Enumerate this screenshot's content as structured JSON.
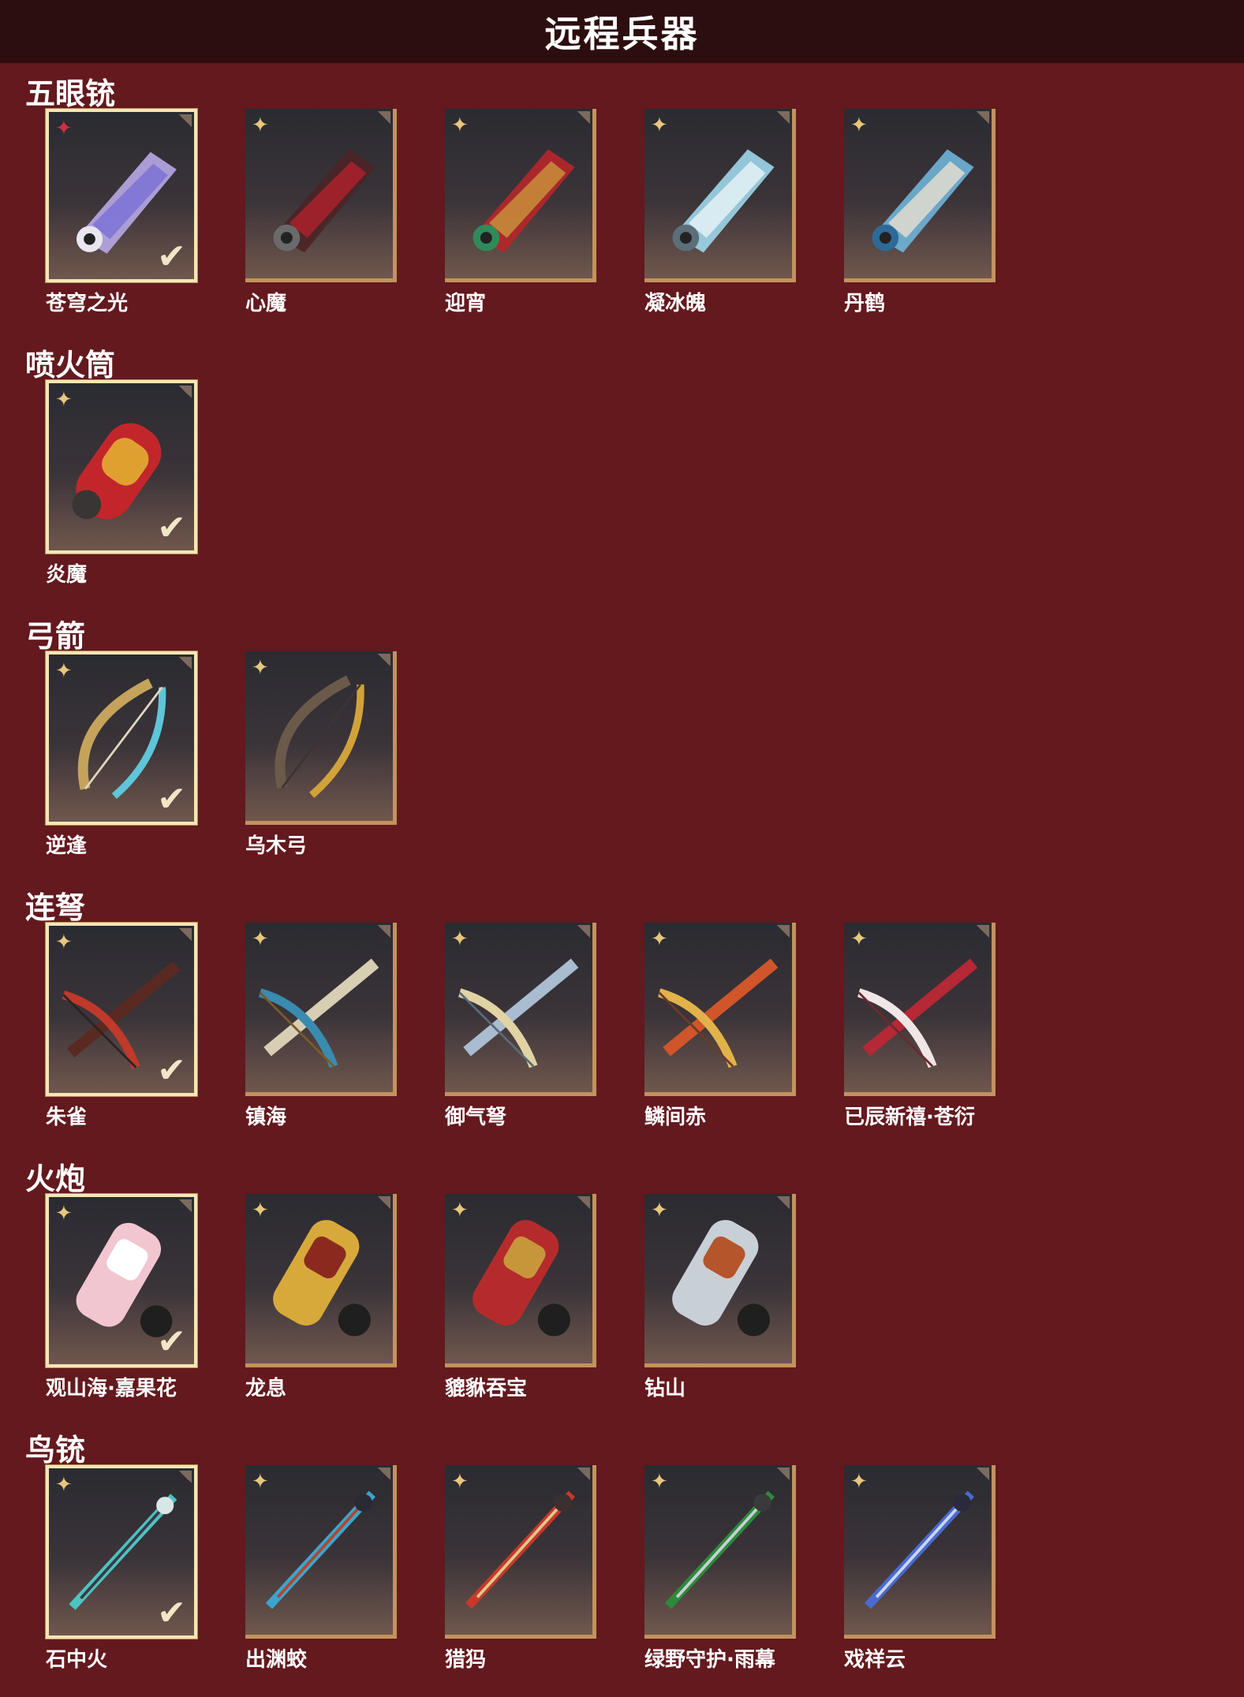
{
  "title": "远程兵器",
  "colors": {
    "background": "#63191e",
    "header": "#2d0e0f",
    "card_border": "#c2935e",
    "selected_border": "#f6e6b6",
    "star_gold": "#e7c77c",
    "star_red": "#cf3045"
  },
  "sections": [
    {
      "title": "五眼铳",
      "items": [
        {
          "name": "苍穹之光",
          "selected": true,
          "badge": "red-star-icon",
          "palette": [
            "#b7a8e6",
            "#7b6fd6",
            "#e9e6f2"
          ]
        },
        {
          "name": "心魔",
          "selected": false,
          "badge": "gold-star-icon",
          "palette": [
            "#4d2326",
            "#b0202c",
            "#6a6a6a"
          ]
        },
        {
          "name": "迎宵",
          "selected": false,
          "badge": "gold-star-icon",
          "palette": [
            "#b7262a",
            "#c9963c",
            "#2f8a5a"
          ]
        },
        {
          "name": "凝冰魄",
          "selected": false,
          "badge": "gold-star-icon",
          "palette": [
            "#9fd6ea",
            "#e8f4f8",
            "#5b6f7a"
          ]
        },
        {
          "name": "丹鹤",
          "selected": false,
          "badge": "gold-star-icon",
          "palette": [
            "#6fb4d8",
            "#e8e0cf",
            "#2d6a98"
          ]
        }
      ]
    },
    {
      "title": "喷火筒",
      "items": [
        {
          "name": "炎魔",
          "selected": true,
          "badge": "gold-star-icon",
          "palette": [
            "#c2262b",
            "#e0a030",
            "#3a3535"
          ]
        }
      ]
    },
    {
      "title": "弓箭",
      "items": [
        {
          "name": "逆逢",
          "selected": true,
          "badge": "gold-star-icon",
          "palette": [
            "#c5a35a",
            "#5ec6d8",
            "#e1d6be"
          ]
        },
        {
          "name": "乌木弓",
          "selected": false,
          "badge": "gold-star-icon",
          "palette": [
            "#6b5a4a",
            "#d2a23a",
            "#3e3333"
          ]
        }
      ]
    },
    {
      "title": "连弩",
      "items": [
        {
          "name": "朱雀",
          "selected": true,
          "badge": "gold-star-icon",
          "palette": [
            "#5a2a22",
            "#c0392b",
            "#2b2222"
          ]
        },
        {
          "name": "镇海",
          "selected": false,
          "badge": "gold-star-icon",
          "palette": [
            "#d8ceb4",
            "#3a8bb0",
            "#7a5a2a"
          ]
        },
        {
          "name": "御气弩",
          "selected": false,
          "badge": "gold-star-icon",
          "palette": [
            "#a9bcd0",
            "#e2d3a4",
            "#5a6a7a"
          ]
        },
        {
          "name": "鳞间赤",
          "selected": false,
          "badge": "gold-star-icon",
          "palette": [
            "#d0552a",
            "#e2b24a",
            "#6a3a2a"
          ]
        },
        {
          "name": "已辰新禧·苍衍",
          "selected": false,
          "badge": "gold-star-icon",
          "palette": [
            "#b52835",
            "#f0e6e6",
            "#6a2a30"
          ]
        }
      ]
    },
    {
      "title": "火炮",
      "items": [
        {
          "name": "观山海·嘉果花",
          "selected": true,
          "badge": "gold-star-icon",
          "palette": [
            "#f1c6d0",
            "#ffffff",
            "#1f1f1f"
          ]
        },
        {
          "name": "龙息",
          "selected": false,
          "badge": "gold-star-icon",
          "palette": [
            "#d7a93b",
            "#8a2a1e",
            "#1f1f1f"
          ]
        },
        {
          "name": "貔貅吞宝",
          "selected": false,
          "badge": "gold-star-icon",
          "palette": [
            "#b52b2b",
            "#c7963b",
            "#1f1f1f"
          ]
        },
        {
          "name": "钻山",
          "selected": false,
          "badge": "gold-star-icon",
          "palette": [
            "#c9cfd6",
            "#b5552b",
            "#1f1f1f"
          ]
        }
      ]
    },
    {
      "title": "鸟铳",
      "items": [
        {
          "name": "石中火",
          "selected": true,
          "badge": "gold-star-icon",
          "palette": [
            "#4ec2c2",
            "#3a3a44",
            "#d8e6e6"
          ]
        },
        {
          "name": "出渊蛟",
          "selected": false,
          "badge": "gold-star-icon",
          "palette": [
            "#3aa6d0",
            "#b5452b",
            "#2a2a34"
          ]
        },
        {
          "name": "猎犸",
          "selected": false,
          "badge": "gold-star-icon",
          "palette": [
            "#c7382b",
            "#e0c98a",
            "#3a3030"
          ]
        },
        {
          "name": "绿野守护·雨幕",
          "selected": false,
          "badge": "gold-star-icon",
          "palette": [
            "#2d8a3a",
            "#c9cfd6",
            "#3a3a3a"
          ]
        },
        {
          "name": "戏祥云",
          "selected": false,
          "badge": "gold-star-icon",
          "palette": [
            "#4a6ad0",
            "#c9d6f0",
            "#2a2a3a"
          ]
        }
      ]
    }
  ]
}
